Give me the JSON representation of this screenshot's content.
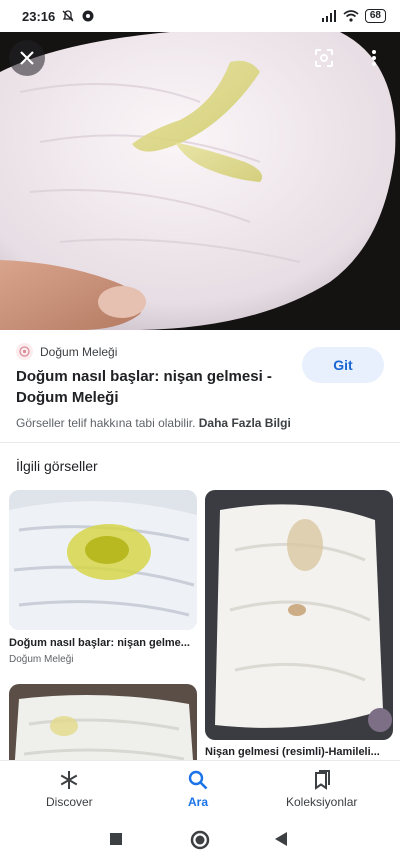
{
  "status_bar": {
    "time": "23:16",
    "battery": "68"
  },
  "hero": {
    "close_icon": "close-icon",
    "lens_icon": "lens-icon",
    "more_icon": "more-vert-icon"
  },
  "result": {
    "source": "Doğum Meleği",
    "title": "Doğum nasıl başlar: nişan gelmesi - Doğum Meleği",
    "visit_label": "Git",
    "copyright_text": "Görseller telif hakkına tabi olabilir.",
    "learn_more": "Daha Fazla Bilgi"
  },
  "related": {
    "heading": "İlgili görseller",
    "items": [
      {
        "caption": "Doğum nasıl başlar: nişan gelme...",
        "source": "Doğum Meleği"
      },
      {
        "caption": "Nişan gelmesi (resimli)-Hamileli...",
        "source": ""
      },
      {
        "caption": "",
        "source": ""
      }
    ]
  },
  "bottom_nav": {
    "items": [
      {
        "label": "Discover",
        "icon": "asterisk-icon"
      },
      {
        "label": "Ara",
        "icon": "search-icon"
      },
      {
        "label": "Koleksiyonlar",
        "icon": "bookmark-collection-icon"
      }
    ],
    "active": "Ara"
  },
  "colors": {
    "accent": "#1a73e8",
    "button_bg": "#e8f0fe"
  }
}
